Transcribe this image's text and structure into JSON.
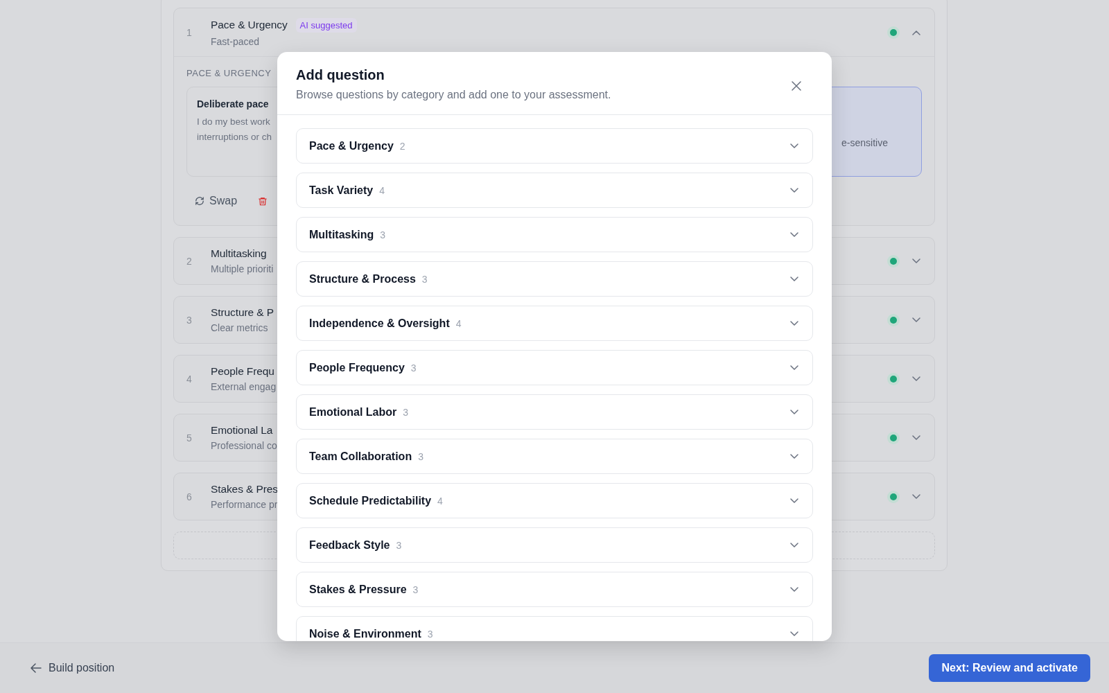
{
  "assessment": {
    "questions": [
      {
        "number": "1",
        "title": "Pace & Urgency",
        "badge": "AI suggested",
        "subtitle": "Fast-paced",
        "expanded": true,
        "section_label": "PACE & URGENCY",
        "options": [
          {
            "title": "Deliberate pace",
            "lines": [
              "I do my best work",
              "interruptions or ch"
            ],
            "selected": false
          },
          {
            "lines": [
              "e-sensitive"
            ],
            "selected": true
          }
        ],
        "actions": {
          "swap": "Swap"
        }
      },
      {
        "number": "2",
        "title": "Multitasking",
        "subtitle": "Multiple prioriti",
        "expanded": false
      },
      {
        "number": "3",
        "title": "Structure & P",
        "subtitle": "Clear metrics",
        "expanded": false
      },
      {
        "number": "4",
        "title": "People Frequ",
        "subtitle": "External engag",
        "expanded": false
      },
      {
        "number": "5",
        "title": "Emotional La",
        "subtitle": "Professional co",
        "expanded": false
      },
      {
        "number": "6",
        "title": "Stakes & Pres",
        "subtitle": "Performance pr",
        "expanded": false
      }
    ]
  },
  "modal": {
    "title": "Add question",
    "subtitle": "Browse questions by category and add one to your assessment.",
    "categories": [
      {
        "name": "Pace & Urgency",
        "count": "2",
        "expanded": false
      },
      {
        "name": "Task Variety",
        "count": "4",
        "expanded": false
      },
      {
        "name": "Multitasking",
        "count": "3",
        "expanded": false
      },
      {
        "name": "Structure & Process",
        "count": "3",
        "expanded": false
      },
      {
        "name": "Independence & Oversight",
        "count": "4",
        "expanded": false
      },
      {
        "name": "People Frequency",
        "count": "3",
        "expanded": false
      },
      {
        "name": "Emotional Labor",
        "count": "3",
        "expanded": false
      },
      {
        "name": "Team Collaboration",
        "count": "3",
        "expanded": false
      },
      {
        "name": "Schedule Predictability",
        "count": "4",
        "expanded": false
      },
      {
        "name": "Feedback Style",
        "count": "3",
        "expanded": false
      },
      {
        "name": "Stakes & Pressure",
        "count": "3",
        "expanded": false
      },
      {
        "name": "Noise & Environment",
        "count": "3",
        "expanded": false
      }
    ]
  },
  "footer": {
    "back": "Build position",
    "next": "Next: Review and activate"
  }
}
